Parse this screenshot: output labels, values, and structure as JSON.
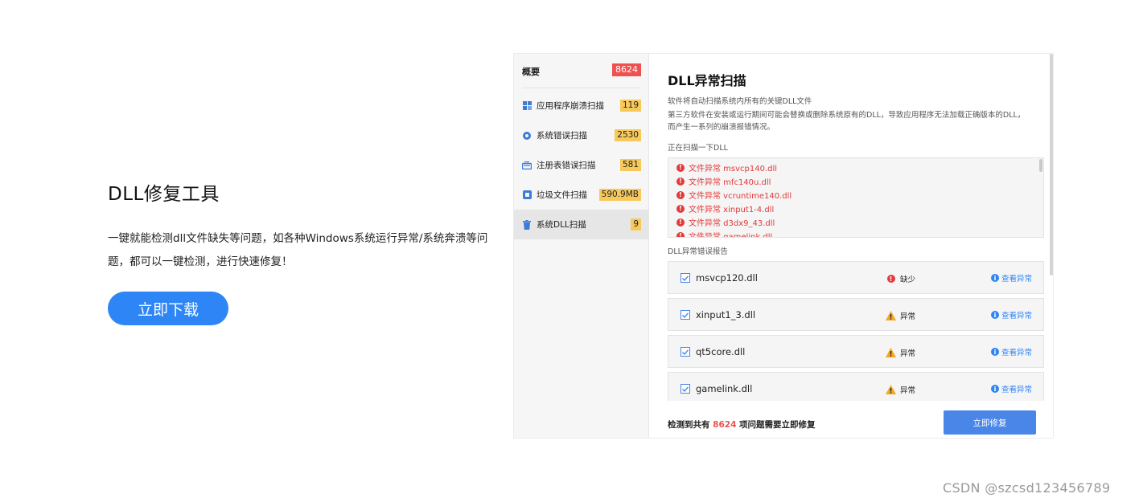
{
  "promo": {
    "title": "DLL修复工具",
    "description": "一键就能检测dll文件缺失等问题，如各种Windows系统运行异常/系统奔溃等问题，都可以一键检测，进行快速修复！",
    "download_label": "立即下载",
    "accent": "#2e86f6"
  },
  "sidebar": {
    "overview_label": "概要",
    "overview_count": "8624",
    "items": [
      {
        "label": "应用程序崩溃扫描",
        "count": "119",
        "icon": "grid-icon"
      },
      {
        "label": "系统错误扫描",
        "count": "2530",
        "icon": "gear-icon"
      },
      {
        "label": "注册表错误扫描",
        "count": "581",
        "icon": "registry-icon"
      },
      {
        "label": "垃圾文件扫描",
        "count": "590.9MB",
        "icon": "junk-icon"
      },
      {
        "label": "系统DLL扫描",
        "count": "9",
        "icon": "trash-icon"
      }
    ]
  },
  "main": {
    "title": "DLL异常扫描",
    "subtitle1": "软件将自动扫描系统内所有的关键DLL文件",
    "subtitle2": "第三方软件在安装或运行期间可能会替换或删除系统原有的DLL，导致应用程序无法加载正确版本的DLL，而产生一系列的崩溃报错情况。",
    "scanning_label": "正在扫描一下DLL",
    "scan_lines": [
      "文件异常 msvcp140.dll",
      "文件异常 mfc140u.dll",
      "文件异常 vcruntime140.dll",
      "文件异常 xinput1-4.dll",
      "文件异常 d3dx9_43.dll",
      "文件异常 gamelink.dll"
    ],
    "report_label": "DLL异常错误报告",
    "rows": [
      {
        "file": "msvcp120.dll",
        "status": "缺少",
        "status_type": "missing",
        "action": "查看异常"
      },
      {
        "file": "xinput1_3.dll",
        "status": "异常",
        "status_type": "warning",
        "action": "查看异常"
      },
      {
        "file": "qt5core.dll",
        "status": "异常",
        "status_type": "warning",
        "action": "查看异常"
      },
      {
        "file": "gamelink.dll",
        "status": "异常",
        "status_type": "warning",
        "action": "查看异常"
      }
    ],
    "summary_prefix": "检测到共有",
    "summary_count": "8624",
    "summary_suffix": "项问题需要立即修复",
    "fix_label": "立即修复"
  },
  "watermark": "CSDN @szcsd123456789",
  "colors": {
    "error": "#e23a3a",
    "warning": "#f5a623",
    "badge_yellow": "#f7c95a",
    "badge_red": "#f05050",
    "button_blue": "#4a86e8"
  }
}
